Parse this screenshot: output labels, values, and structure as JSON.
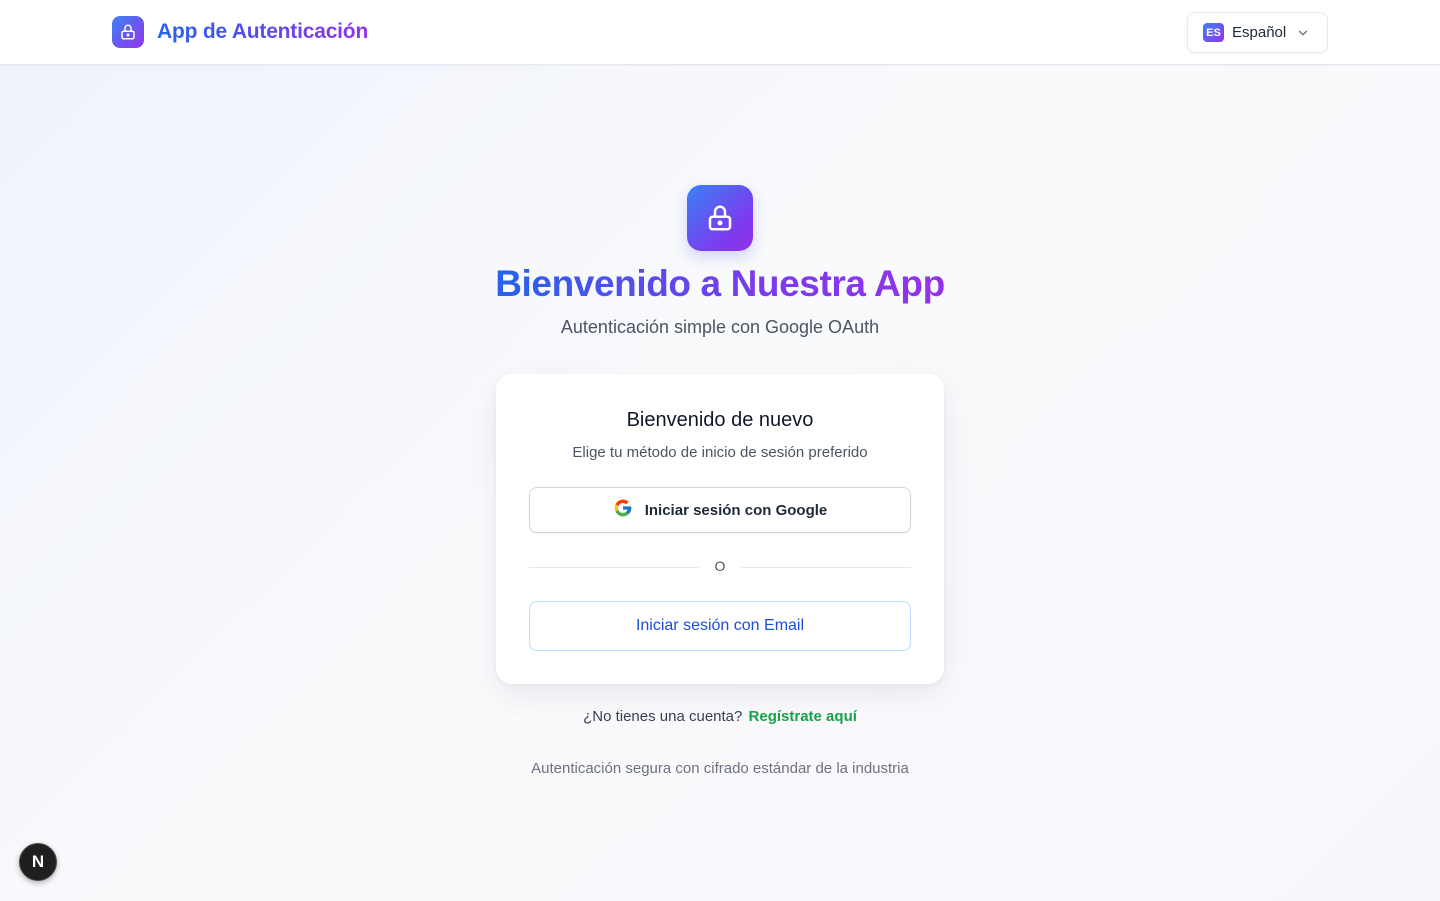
{
  "header": {
    "brand_title": "App de Autenticación",
    "language": {
      "code": "ES",
      "label": "Español"
    }
  },
  "hero": {
    "title": "Bienvenido a Nuestra App",
    "subtitle": "Autenticación simple con Google OAuth"
  },
  "card": {
    "title": "Bienvenido de nuevo",
    "subtitle": "Elige tu método de inicio de sesión preferido",
    "google_button": "Iniciar sesión con Google",
    "divider": "O",
    "email_button": "Iniciar sesión con Email"
  },
  "signup": {
    "prompt": "¿No tienes una cuenta?",
    "link": "Regístrate aquí"
  },
  "footer_note": "Autenticación segura con cifrado estándar de la industria",
  "dev_badge": {
    "letter": "N"
  },
  "colors": {
    "brand_gradient_start": "#2563eb",
    "brand_gradient_end": "#9333ea",
    "link_green": "#16a34a",
    "email_button_text": "#1d4ed8"
  },
  "icons": {
    "brand": "lock-icon",
    "hero": "lock-icon",
    "language_dropdown": "chevron-down-icon",
    "google": "google-icon"
  }
}
